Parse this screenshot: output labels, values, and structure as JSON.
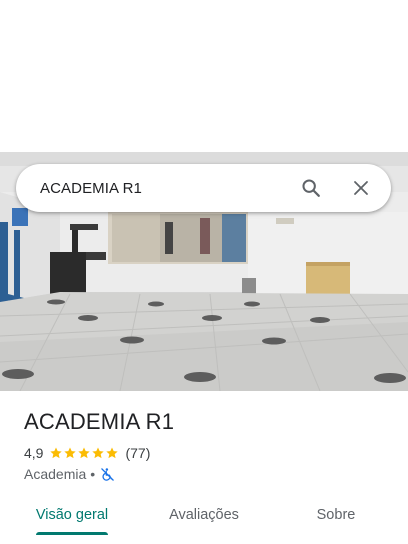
{
  "search": {
    "query": "ACADEMIA R1"
  },
  "icons": {
    "search": "search-icon",
    "close": "close-icon",
    "accessibility": "not-wheelchair-accessible-icon"
  },
  "place": {
    "name": "ACADEMIA R1",
    "rating": "4,9",
    "stars": 5,
    "review_count": "(77)",
    "category": "Academia",
    "separator": "•"
  },
  "tabs": [
    {
      "label": "Visão geral",
      "active": true
    },
    {
      "label": "Avaliações",
      "active": false
    },
    {
      "label": "Sobre",
      "active": false
    }
  ],
  "colors": {
    "accent": "#01796f",
    "star": "#fbbc04",
    "access_icon": "#1a73e8"
  }
}
